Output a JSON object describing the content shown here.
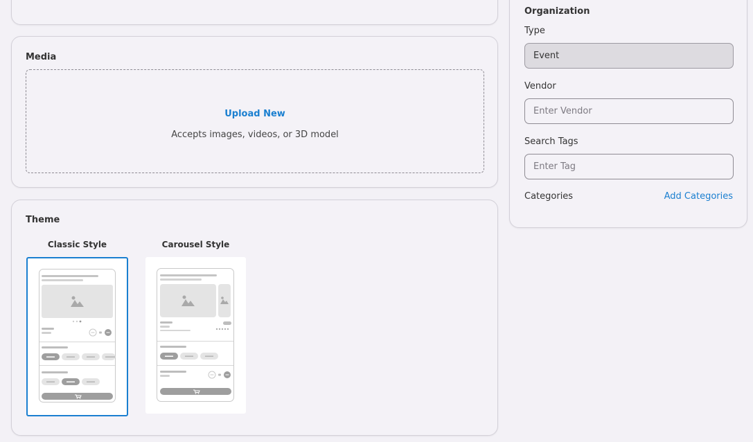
{
  "media": {
    "title": "Media",
    "upload_label": "Upload New",
    "accepts_text": "Accepts images, videos, or 3D model"
  },
  "theme": {
    "title": "Theme",
    "options": [
      {
        "label": "Classic Style",
        "selected": true
      },
      {
        "label": "Carousel Style",
        "selected": false
      }
    ]
  },
  "organization": {
    "title": "Organization",
    "type_label": "Type",
    "type_value": "Event",
    "vendor_label": "Vendor",
    "vendor_placeholder": "Enter Vendor",
    "tags_label": "Search Tags",
    "tags_placeholder": "Enter Tag",
    "categories_label": "Categories",
    "add_categories_label": "Add Categories"
  },
  "colors": {
    "accent": "#1a7fd0",
    "background": "#f3f1f6"
  }
}
